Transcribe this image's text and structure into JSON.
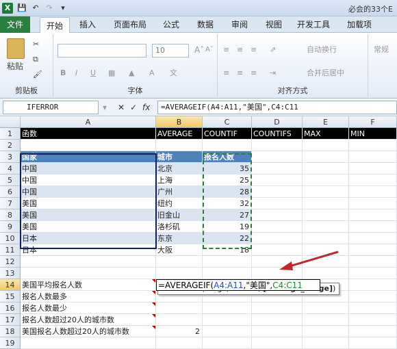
{
  "window": {
    "title": "必会的33个E"
  },
  "quick_access": {
    "excel_icon": "X",
    "save_icon": "save-icon",
    "undo_icon": "undo-icon",
    "redo_icon": "redo-icon",
    "dropdown": "▾"
  },
  "tabs": [
    {
      "label": "文件"
    },
    {
      "label": "开始"
    },
    {
      "label": "插入"
    },
    {
      "label": "页面布局"
    },
    {
      "label": "公式"
    },
    {
      "label": "数据"
    },
    {
      "label": "审阅"
    },
    {
      "label": "视图"
    },
    {
      "label": "开发工具"
    },
    {
      "label": "加载项"
    }
  ],
  "ribbon": {
    "clipboard": {
      "label": "剪贴板",
      "paste": "粘贴"
    },
    "font": {
      "label": "字体",
      "size": "10",
      "bold": "B",
      "italic": "I",
      "underline": "U"
    },
    "alignment": {
      "label": "对齐方式",
      "wrap": "自动换行",
      "merge": "合并后居中"
    },
    "number": {
      "format": "常规"
    }
  },
  "formula_bar": {
    "name_box": "IFERROR",
    "cancel": "✕",
    "enter": "✓",
    "fx": "fx",
    "formula": "=AVERAGEIF(A4:A11,\"美国\",C4:C11"
  },
  "columns": [
    "A",
    "B",
    "C",
    "D",
    "E",
    "F"
  ],
  "rows": [
    "1",
    "2",
    "3",
    "4",
    "5",
    "6",
    "7",
    "8",
    "9",
    "10",
    "11",
    "12",
    "13",
    "14",
    "15",
    "16",
    "17",
    "18",
    "19"
  ],
  "row1": [
    "函数",
    "AVERAGE",
    "COUNTIF",
    "COUNTIFS",
    "MAX",
    "MIN"
  ],
  "table_header": [
    "国家",
    "城市",
    "报名人数"
  ],
  "table_rows": [
    [
      "中国",
      "北京",
      "35"
    ],
    [
      "中国",
      "上海",
      "25"
    ],
    [
      "中国",
      "广州",
      "28"
    ],
    [
      "美国",
      "纽约",
      "32"
    ],
    [
      "美国",
      "旧金山",
      "27"
    ],
    [
      "美国",
      "洛杉矶",
      "19"
    ],
    [
      "日本",
      "东京",
      "22"
    ],
    [
      "日本",
      "大阪",
      "18"
    ]
  ],
  "questions": [
    {
      "label": "美国平均报名人数",
      "value": ""
    },
    {
      "label": "报名人数最多",
      "value": ""
    },
    {
      "label": "报名人数最少",
      "value": ""
    },
    {
      "label": "报名人数超过20人的城市数",
      "value": ""
    },
    {
      "label": "美国报名人数超过20人的城市数",
      "value": "2"
    }
  ],
  "editing": {
    "prefix": "=AVERAGEIF(",
    "range1": "A4:A11",
    "sep1": ",\"美国\",",
    "range2": "C4:C11"
  },
  "tooltip": {
    "text": "AVERAGEIF(range, criteria, ",
    "bold": "[average_range]",
    "end": ")"
  },
  "colors": {
    "table_header": "#4f81bd",
    "band": "#dbe5f1",
    "file_tab": "#2a7e3e",
    "arrow": "#c0282d"
  }
}
